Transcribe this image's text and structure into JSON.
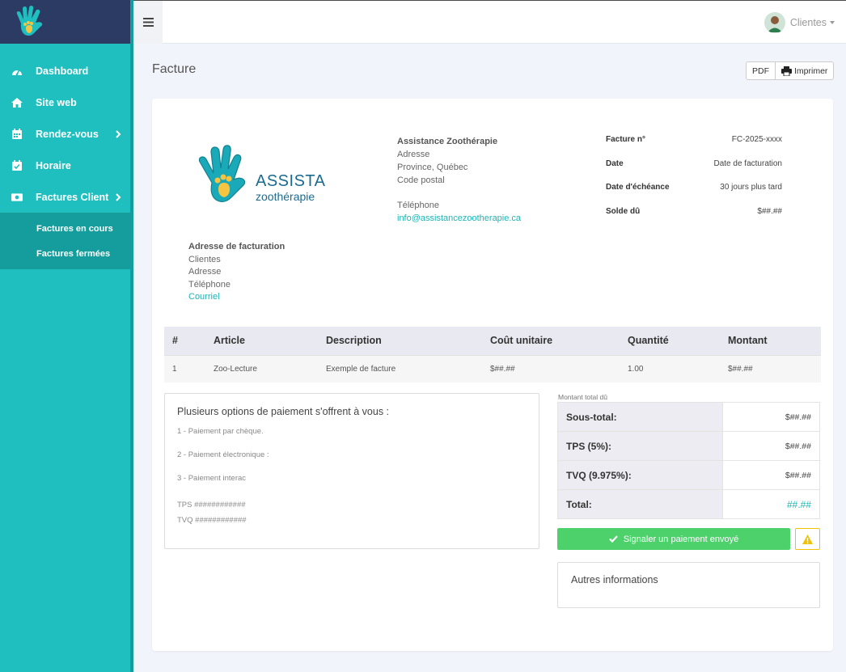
{
  "sidebar": {
    "logo_icon": "paw-hand-logo-icon",
    "items": [
      {
        "label": "Dashboard",
        "icon": "gauge-icon"
      },
      {
        "label": "Site web",
        "icon": "home-icon"
      },
      {
        "label": "Rendez-vous",
        "icon": "calendar-icon"
      },
      {
        "label": "Horaire",
        "icon": "calendar-check-icon"
      },
      {
        "label": "Factures Client",
        "icon": "money-icon"
      }
    ],
    "subitems": [
      "Factures en cours",
      "Factures fermées"
    ]
  },
  "topbar": {
    "user_label": "Clientes"
  },
  "page": {
    "title": "Facture",
    "pdf_label": "PDF",
    "print_label": "Imprimer"
  },
  "logo": {
    "line1": "ASSISTANCE",
    "line2": "zoothérapie"
  },
  "company": {
    "name": "Assistance Zoothérapie",
    "address": "Adresse",
    "province": "Province, Québec",
    "postal": "Code postal",
    "phone": "Téléphone",
    "email": "info@assistancezootherapie.ca"
  },
  "meta": [
    {
      "k": "Facture n°",
      "v": "FC-2025-xxxx"
    },
    {
      "k": "Date",
      "v": "Date de facturation"
    },
    {
      "k": "Date d'échéance",
      "v": "30 jours plus tard"
    },
    {
      "k": "Solde dû",
      "v": "$##.##"
    }
  ],
  "billing": {
    "heading": "Adresse de facturation",
    "client": "Clientes",
    "address": "Adresse",
    "phone": "Téléphone",
    "email": "Courriel"
  },
  "items": {
    "headers": [
      "#",
      "Article",
      "Description",
      "Coût unitaire",
      "Quantité",
      "Montant"
    ],
    "rows": [
      [
        "1",
        "Zoo-Lecture",
        "Exemple de facture",
        "$##.##",
        "1.00",
        "$##.##"
      ]
    ]
  },
  "payment": {
    "heading": "Plusieurs options de paiement s'offrent à vous :",
    "options": [
      "1 - Paiement par chèque.",
      "2 - Paiement électronique :",
      "3 - Paiement interac"
    ],
    "tps": "TPS ############",
    "tvq": "TVQ ############"
  },
  "totals": {
    "caption": "Montant total dû",
    "rows": [
      {
        "k": "Sous-total:",
        "v": "$##.##"
      },
      {
        "k": "TPS (5%):",
        "v": "$##.##"
      },
      {
        "k": "TVQ (9.975%):",
        "v": "$##.##"
      },
      {
        "k": "Total:",
        "v": "##.##"
      }
    ]
  },
  "actions": {
    "signal_label": "Signaler un paiement envoyé"
  },
  "other": {
    "label": "Autres informations"
  },
  "colors": {
    "sidebar": "#1fbfbf",
    "brand": "#2c3b63",
    "accent": "#1fb4b4",
    "success": "#4cd16b",
    "warning": "#f2c200"
  }
}
